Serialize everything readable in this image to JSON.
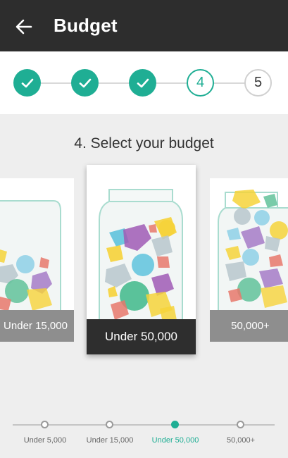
{
  "app_bar": {
    "title": "Budget",
    "back_icon": "arrow-left-icon"
  },
  "stepper": {
    "steps": [
      {
        "state": "done",
        "icon": "check-icon"
      },
      {
        "state": "done",
        "icon": "check-icon"
      },
      {
        "state": "done",
        "icon": "check-icon"
      },
      {
        "state": "current",
        "number": "4"
      },
      {
        "state": "todo",
        "number": "5"
      }
    ],
    "accent_color": "#1fae94"
  },
  "heading": "4. Select your budget",
  "cards": [
    {
      "label": "Under 15,000",
      "state": "partially-visible-left"
    },
    {
      "label": "Under 50,000",
      "state": "selected"
    },
    {
      "label": "50,000+",
      "state": "partially-visible-right"
    }
  ],
  "budget_slider": {
    "options": [
      "Under 5,000",
      "Under 15,000",
      "Under 50,000",
      "50,000+"
    ],
    "selected_index": 2
  },
  "colors": {
    "app_bar": "#2d2d2d",
    "accent": "#1fae94",
    "background": "#eeeeee"
  }
}
